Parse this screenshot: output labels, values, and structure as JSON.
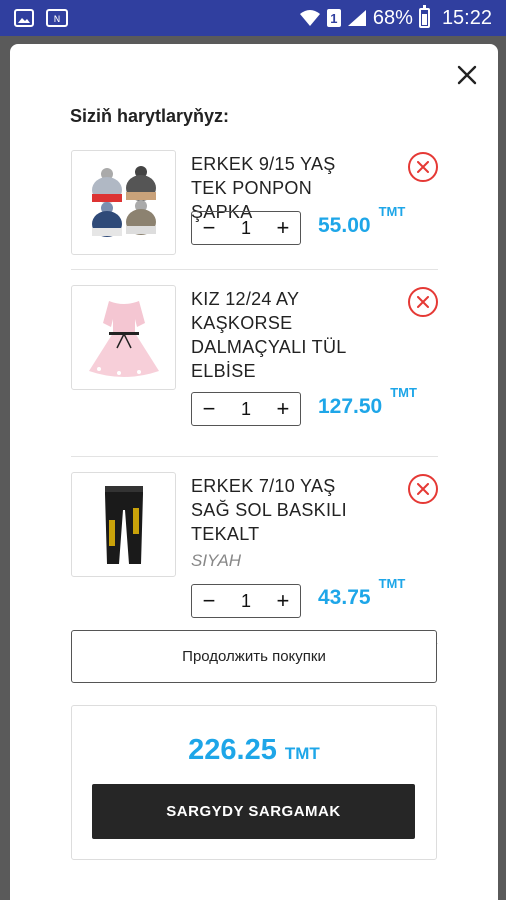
{
  "status_bar": {
    "battery_percent": "68%",
    "time": "15:22",
    "sim_label": "1",
    "battery_level": 0.68
  },
  "cart": {
    "title": "Siziň harytlaryňyz:",
    "items": [
      {
        "name": "ERKEK 9/15 YAŞ TEK PONPON ŞAPKA",
        "variant": "",
        "quantity": "1",
        "price": "55.00",
        "currency": "TMT"
      },
      {
        "name": "KIZ 12/24 AY KAŞKORSE DALMAÇYALI TÜL ELBİSE",
        "variant": "",
        "quantity": "1",
        "price": "127.50",
        "currency": "TMT"
      },
      {
        "name": "ERKEK 7/10 YAŞ SAĞ SOL BASKILI TEKALT",
        "variant": "SIYAH",
        "quantity": "1",
        "price": "43.75",
        "currency": "TMT"
      }
    ],
    "decrement_symbol": "−",
    "increment_symbol": "+"
  },
  "continue_label": "Продолжить покупки",
  "total": {
    "amount": "226.25",
    "currency": "TMT"
  },
  "checkout_label": "SARGYDY SARGAMAK",
  "colors": {
    "accent": "#1ea6e8",
    "remove": "#e53935",
    "status_bar": "#303f9f",
    "checkout_bg": "#262626"
  },
  "icons": [
    "image-icon",
    "nfc-icon",
    "wifi-icon",
    "signal-icon",
    "battery-icon",
    "close-icon",
    "remove-icon"
  ]
}
